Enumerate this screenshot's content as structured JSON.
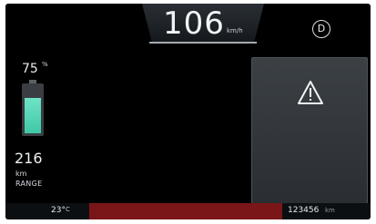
{
  "speed": {
    "value": "106",
    "unit": "km/h"
  },
  "gear": {
    "label": "D"
  },
  "battery": {
    "percent": "75",
    "percent_unit": "%",
    "level_percent": 75,
    "fill_color": "#5ad9ba"
  },
  "range": {
    "value": "216",
    "unit": "km",
    "label": "RANGE"
  },
  "warning": {
    "icon": "warning-triangle-icon"
  },
  "status_bar": {
    "outside_temp": "23°",
    "outside_temp_unit": "C",
    "odometer": "123456",
    "odometer_unit": "km",
    "alert_color": "#7a1518"
  }
}
